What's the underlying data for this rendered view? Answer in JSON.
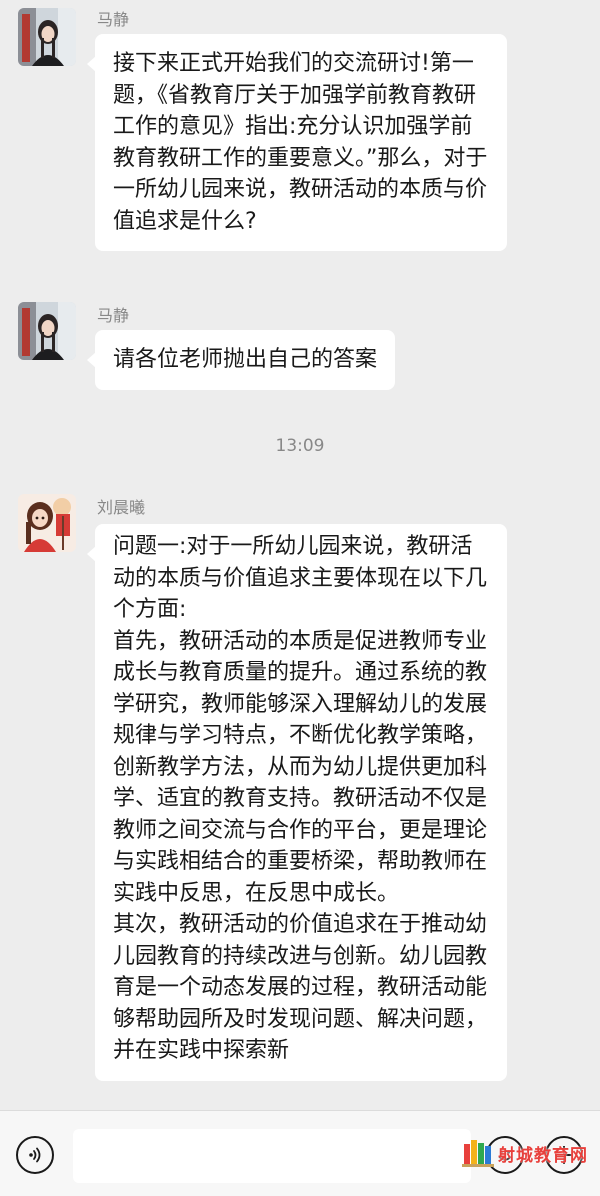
{
  "messages": [
    {
      "sender": "马静",
      "text": "接下来正式开始我们的交流研讨!第一题，《省教育厅关于加强学前教育教研工作的意见》指出:充分认识加强学前教育教研工作的重要意义。”那么，对于一所幼儿园来说，教研活动的本质与价值追求是什么?"
    },
    {
      "sender": "马静",
      "text": "请各位老师抛出自己的答案"
    },
    {
      "sender": "刘晨曦",
      "text": "问题一:对于一所幼儿园来说，教研活动的本质与价值追求主要体现在以下几个方面:\n首先，教研活动的本质是促进教师专业成长与教育质量的提升。通过系统的教学研究，教师能够深入理解幼儿的发展规律与学习特点，不断优化教学策略，创新教学方法，从而为幼儿提供更加科学、适宜的教育支持。教研活动不仅是教师之间交流与合作的平台，更是理论与实践相结合的重要桥梁，帮助教师在实践中反思，在反思中成长。\n其次，教研活动的价值追求在于推动幼儿园教育的持续改进与创新。幼儿园教育是一个动态发展的过程，教研活动能够帮助园所及时发现问题、解决问题，并在实践中探索新"
    }
  ],
  "timestamp": "13:09",
  "watermark": {
    "text": "射城教育网",
    "colors": [
      "#e8403c",
      "#f3b21a",
      "#2fa84f",
      "#2b7bd6"
    ]
  },
  "icons": {
    "voice": "voice-icon",
    "emoji": "emoji-icon",
    "add": "plus-icon"
  }
}
